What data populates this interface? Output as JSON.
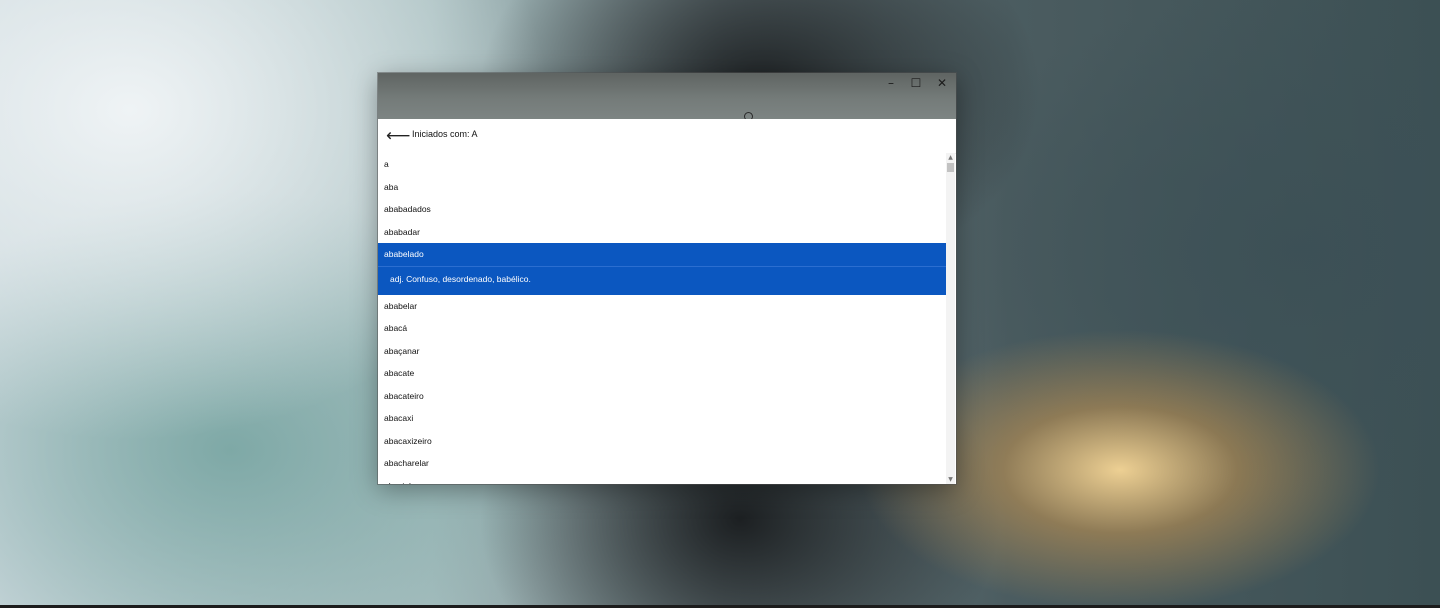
{
  "window": {
    "controls": {
      "minimize_icon": "–",
      "maximize_icon": "☐",
      "close_icon": "✕"
    }
  },
  "header": {
    "back_icon": "⟵",
    "title": "Iniciados com: A"
  },
  "list": {
    "items_before": [
      "a",
      "aba",
      "ababadados",
      "ababadar"
    ],
    "selected_word": "ababelado",
    "selected_definition": "adj. Confuso, desordenado, babélico.",
    "items_after": [
      "ababelar",
      "abacá",
      "abaçanar",
      "abacate",
      "abacateiro",
      "abacaxi",
      "abacaxizeiro",
      "abacharelar",
      "abacial"
    ]
  },
  "scrollbar": {
    "up_icon": "▲",
    "down_icon": "▼"
  },
  "colors": {
    "selection": "#0b57c0",
    "titlebar": "#747b79"
  }
}
